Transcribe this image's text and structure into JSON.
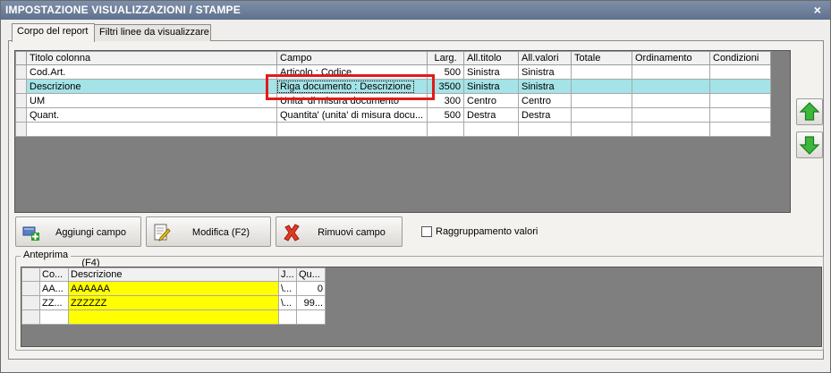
{
  "window": {
    "title": "IMPOSTAZIONE VISUALIZZAZIONI / STAMPE",
    "close_glyph": "×"
  },
  "tabs": [
    {
      "label": "Corpo del report",
      "active": true
    },
    {
      "label": "Filtri linee da visualizzare",
      "active": false
    }
  ],
  "columns_grid": {
    "headers": [
      "Titolo colonna",
      "Campo",
      "Larg.",
      "All.titolo",
      "All.valori",
      "Totale",
      "Ordinamento",
      "Condizioni"
    ],
    "rows": [
      {
        "titolo": "Cod.Art.",
        "campo": "Articolo : Codice",
        "larg": "500",
        "all_titolo": "Sinistra",
        "all_valori": "Sinistra",
        "totale": "",
        "ordinamento": "",
        "condizioni": ""
      },
      {
        "titolo": "Descrizione",
        "campo": "Riga documento : Descrizione",
        "larg": "3500",
        "all_titolo": "Sinistra",
        "all_valori": "Sinistra",
        "totale": "",
        "ordinamento": "",
        "condizioni": "",
        "selected": true
      },
      {
        "titolo": "UM",
        "campo": "Unita' di misura documento",
        "larg": "300",
        "all_titolo": "Centro",
        "all_valori": "Centro",
        "totale": "",
        "ordinamento": "",
        "condizioni": ""
      },
      {
        "titolo": "Quant.",
        "campo": "Quantita' (unita' di misura docu...",
        "larg": "500",
        "all_titolo": "Destra",
        "all_valori": "Destra",
        "totale": "",
        "ordinamento": "",
        "condizioni": ""
      }
    ]
  },
  "side_buttons": {
    "up_icon": "arrow-up-icon",
    "down_icon": "arrow-down-icon"
  },
  "actions": {
    "add_label": "Aggiungi campo (F4)",
    "edit_label": "Modifica (F2)",
    "remove_label": "Rimuovi campo",
    "group_values_label": "Raggruppamento valori",
    "group_values_checked": false
  },
  "preview": {
    "title": "Anteprima",
    "headers": [
      "Co...",
      "Descrizione",
      "J...",
      "Qu..."
    ],
    "rows": [
      [
        "AA...",
        "AAAAAA",
        "\\...",
        "0"
      ],
      [
        "ZZ...",
        "ZZZZZZ",
        "\\...",
        "99..."
      ]
    ]
  },
  "colors": {
    "selected_row": "#a4e3e7",
    "highlight_box": "#e01b1b",
    "preview_fill": "#ffff00",
    "titlebar": "#6f809c"
  }
}
